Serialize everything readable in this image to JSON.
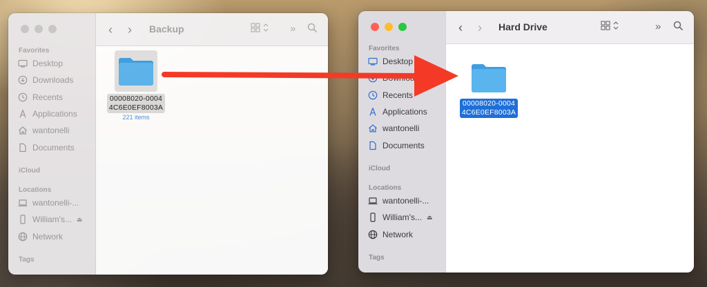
{
  "left_window": {
    "title": "Backup",
    "sidebar": {
      "favorites_label": "Favorites",
      "items": [
        {
          "label": "Desktop",
          "icon": "desktop-icon"
        },
        {
          "label": "Downloads",
          "icon": "downloads-icon"
        },
        {
          "label": "Recents",
          "icon": "clock-icon"
        },
        {
          "label": "Applications",
          "icon": "applications-icon"
        },
        {
          "label": "wantonelli",
          "icon": "home-icon"
        },
        {
          "label": "Documents",
          "icon": "document-icon"
        }
      ],
      "icloud_label": "iCloud",
      "locations_label": "Locations",
      "locations": [
        {
          "label": "wantonelli-...",
          "icon": "laptop-icon"
        },
        {
          "label": "William's...",
          "icon": "phone-icon"
        },
        {
          "label": "Network",
          "icon": "globe-icon"
        }
      ],
      "tags_label": "Tags"
    },
    "folder": {
      "name_line1": "00008020-0004",
      "name_line2": "4C6E0EF8003A",
      "item_count": "221 items"
    }
  },
  "right_window": {
    "title": "Hard Drive",
    "sidebar": {
      "favorites_label": "Favorites",
      "items": [
        {
          "label": "Desktop",
          "icon": "desktop-icon"
        },
        {
          "label": "Downloads",
          "icon": "downloads-icon"
        },
        {
          "label": "Recents",
          "icon": "clock-icon"
        },
        {
          "label": "Applications",
          "icon": "applications-icon"
        },
        {
          "label": "wantonelli",
          "icon": "home-icon"
        },
        {
          "label": "Documents",
          "icon": "document-icon"
        }
      ],
      "icloud_label": "iCloud",
      "locations_label": "Locations",
      "locations": [
        {
          "label": "wantonelli-...",
          "icon": "laptop-icon"
        },
        {
          "label": "William's...",
          "icon": "phone-icon"
        },
        {
          "label": "Network",
          "icon": "globe-icon"
        }
      ],
      "tags_label": "Tags"
    },
    "folder": {
      "name_line1": "00008020-0004",
      "name_line2": "4C6E0EF8003A"
    }
  },
  "colors": {
    "accent": "#1f6fd8",
    "folder_blue": "#5ab4ee",
    "arrow_red": "#f43a26"
  }
}
